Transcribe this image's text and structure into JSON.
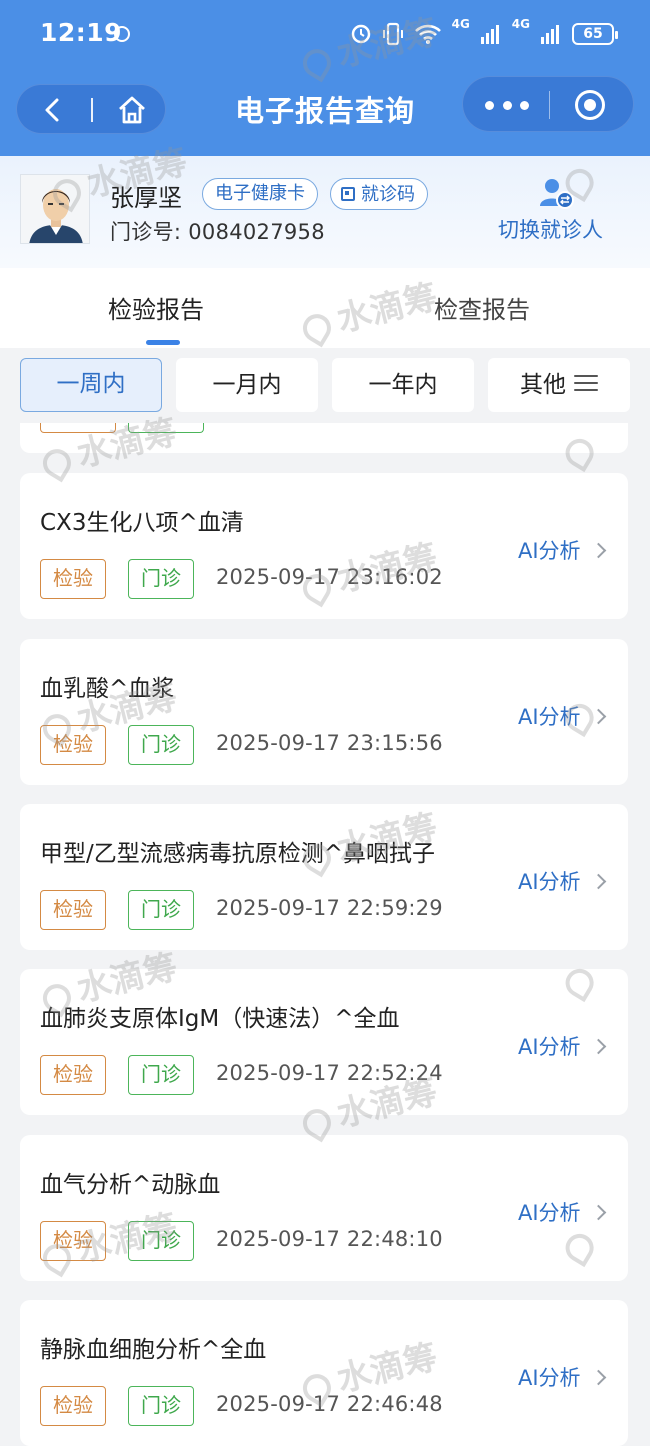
{
  "status_bar": {
    "time": "12:19",
    "network_1": "4G",
    "network_2": "4G",
    "battery": "65"
  },
  "nav": {
    "title": "电子报告查询"
  },
  "patient": {
    "name": "张厚坚",
    "health_card_label": "电子健康卡",
    "visit_code_label": "就诊码",
    "clinic_id": "门诊号: 0084027958",
    "switch_label": "切换就诊人"
  },
  "tabs": [
    {
      "label": "检验报告",
      "active": true
    },
    {
      "label": "检查报告",
      "active": false
    }
  ],
  "filters": [
    {
      "label": "一周内",
      "active": true
    },
    {
      "label": "一月内",
      "active": false
    },
    {
      "label": "一年内",
      "active": false
    },
    {
      "label": "其他",
      "active": false
    }
  ],
  "reports": [
    {
      "title": "CX3生化八项^血清",
      "kind": "检验",
      "dept": "门诊",
      "time": "2025-09-17 23:16:02",
      "action": "AI分析"
    },
    {
      "title": "血乳酸^血浆",
      "kind": "检验",
      "dept": "门诊",
      "time": "2025-09-17 23:15:56",
      "action": "AI分析"
    },
    {
      "title": "甲型/乙型流感病毒抗原检测^鼻咽拭子",
      "kind": "检验",
      "dept": "门诊",
      "time": "2025-09-17 22:59:29",
      "action": "AI分析"
    },
    {
      "title": "血肺炎支原体IgM（快速法）^全血",
      "kind": "检验",
      "dept": "门诊",
      "time": "2025-09-17 22:52:24",
      "action": "AI分析"
    },
    {
      "title": "血气分析^动脉血",
      "kind": "检验",
      "dept": "门诊",
      "time": "2025-09-17 22:48:10",
      "action": "AI分析"
    },
    {
      "title": "静脉血细胞分析^全血",
      "kind": "检验",
      "dept": "门诊",
      "time": "2025-09-17 22:46:48",
      "action": "AI分析"
    }
  ],
  "watermark": "水滴筹",
  "colors": {
    "header_blue": "#4b8fe6",
    "link_blue": "#2f6fc5",
    "kind_orange": "#d48a44",
    "dept_green": "#3fa84c"
  }
}
